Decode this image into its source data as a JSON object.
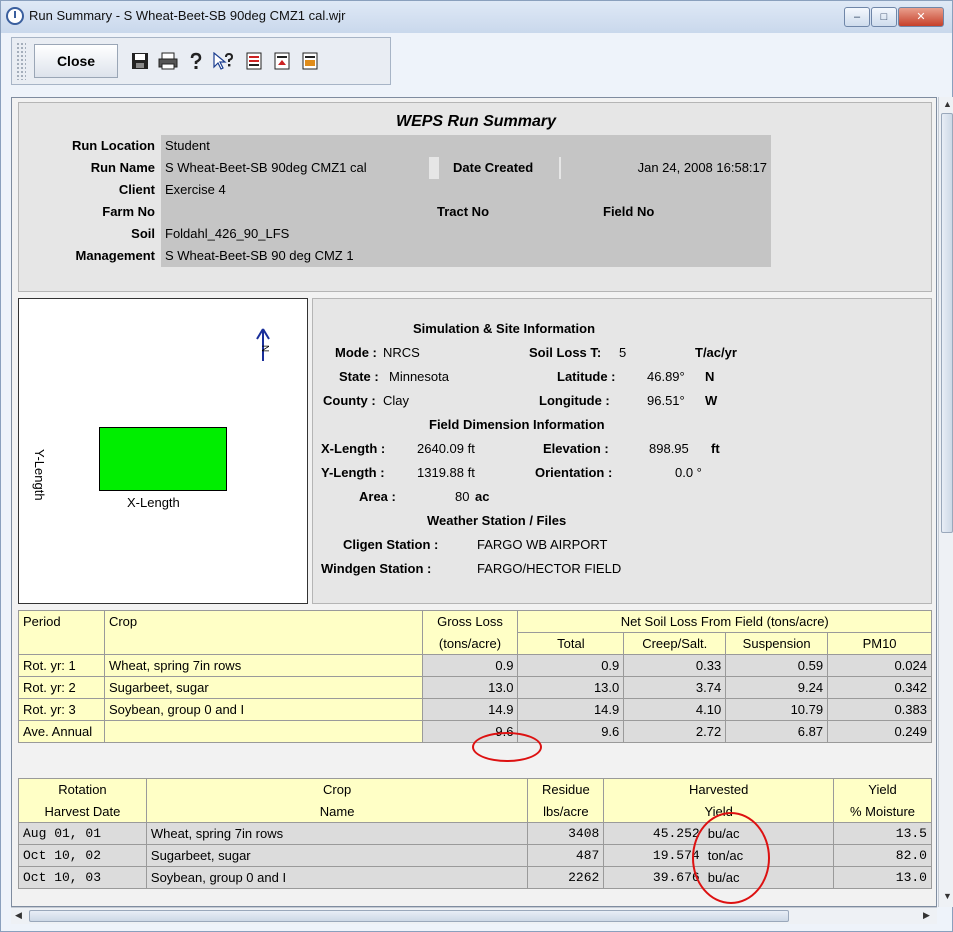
{
  "window": {
    "title": "Run Summary - S Wheat-Beet-SB 90deg CMZ1 cal.wjr",
    "minimize_label": "–",
    "maximize_label": "□",
    "close_label": "✕"
  },
  "toolbar": {
    "close_label": "Close",
    "icons": [
      "save-icon",
      "print-icon",
      "help-icon",
      "context-help-icon",
      "report-red-icon",
      "report-export-icon",
      "report-pdf-icon"
    ]
  },
  "summary": {
    "title": "WEPS Run Summary",
    "run_location_label": "Run Location",
    "run_location": "Student",
    "run_name_label": "Run Name",
    "run_name": "S Wheat-Beet-SB 90deg CMZ1 cal",
    "date_created_label": "Date Created",
    "date_created": "Jan 24, 2008 16:58:17",
    "client_label": "Client",
    "client": "Exercise 4",
    "farm_no_label": "Farm No",
    "farm_no": "",
    "tract_no_label": "Tract No",
    "tract_no": "",
    "field_no_label": "Field No",
    "field_no": "",
    "soil_label": "Soil",
    "soil": "Foldahl_426_90_LFS",
    "management_label": "Management",
    "management": "S Wheat-Beet-SB 90 deg CMZ 1"
  },
  "field_map": {
    "north_label": "N",
    "x_label": "X-Length",
    "y_label": "Y-Length",
    "field_color": "#00ee00"
  },
  "site_info": {
    "sim_title": "Simulation & Site Information",
    "mode_label": "Mode :",
    "mode": "NRCS",
    "soil_loss_t_label": "Soil Loss T:",
    "soil_loss_t": "5",
    "soil_loss_t_unit": "T/ac/yr",
    "state_label": "State :",
    "state": "Minnesota",
    "latitude_label": "Latitude :",
    "latitude": "46.89°",
    "latitude_dir": "N",
    "county_label": "County :",
    "county": "Clay",
    "longitude_label": "Longitude :",
    "longitude": "96.51°",
    "longitude_dir": "W",
    "field_dim_title": "Field Dimension Information",
    "x_length_label": "X-Length :",
    "x_length": "2640.09 ft",
    "elevation_label": "Elevation :",
    "elevation": "898.95",
    "elevation_unit": "ft",
    "y_length_label": "Y-Length :",
    "y_length": "1319.88 ft",
    "orientation_label": "Orientation :",
    "orientation": "0.0 °",
    "area_label": "Area :",
    "area": "80",
    "area_unit": "ac",
    "weather_title": "Weather Station / Files",
    "cligen_label": "Cligen Station :",
    "cligen": "FARGO WB AIRPORT",
    "windgen_label": "Windgen Station :",
    "windgen": "FARGO/HECTOR FIELD"
  },
  "soil_loss": {
    "h_period": "Period",
    "h_crop": "Crop",
    "h_gross_1": "Gross Loss",
    "h_gross_2": "(tons/acre)",
    "h_net": "Net Soil Loss From Field (tons/acre)",
    "h_total": "Total",
    "h_creep": "Creep/Salt.",
    "h_susp": "Suspension",
    "h_pm10": "PM10",
    "rows": [
      {
        "period": "Rot. yr:  1",
        "crop": "Wheat, spring 7in rows",
        "gross": "0.9",
        "total": "0.9",
        "creep": "0.33",
        "susp": "0.59",
        "pm10": "0.024"
      },
      {
        "period": "Rot. yr:  2",
        "crop": "Sugarbeet, sugar",
        "gross": "13.0",
        "total": "13.0",
        "creep": "3.74",
        "susp": "9.24",
        "pm10": "0.342"
      },
      {
        "period": "Rot. yr:  3",
        "crop": "Soybean, group 0 and I",
        "gross": "14.9",
        "total": "14.9",
        "creep": "4.10",
        "susp": "10.79",
        "pm10": "0.383"
      },
      {
        "period": "Ave. Annual",
        "crop": "",
        "gross": "9.6",
        "total": "9.6",
        "creep": "2.72",
        "susp": "6.87",
        "pm10": "0.249"
      }
    ]
  },
  "harvest": {
    "h_date_1": "Rotation",
    "h_date_2": "Harvest Date",
    "h_crop_1": "Crop",
    "h_crop_2": "Name",
    "h_res_1": "Residue",
    "h_res_2": "lbs/acre",
    "h_yield_1": "Harvested",
    "h_yield_2": "Yield",
    "h_moist_1": "Yield",
    "h_moist_2": "% Moisture",
    "rows": [
      {
        "date": "Aug 01, 01",
        "crop": "Wheat, spring 7in rows",
        "residue": "3408",
        "yield": "45.252",
        "unit": "bu/ac",
        "moisture": "13.5"
      },
      {
        "date": "Oct 10, 02",
        "crop": "Sugarbeet, sugar",
        "residue": "487",
        "yield": "19.574",
        "unit": "ton/ac",
        "moisture": "82.0"
      },
      {
        "date": "Oct 10, 03",
        "crop": "Soybean, group 0 and I",
        "residue": "2262",
        "yield": "39.676",
        "unit": "bu/ac",
        "moisture": "13.0"
      }
    ]
  },
  "scroll": {
    "up_arrow": "▲",
    "down_arrow": "▼",
    "left_arrow": "◀",
    "right_arrow": "▶"
  }
}
